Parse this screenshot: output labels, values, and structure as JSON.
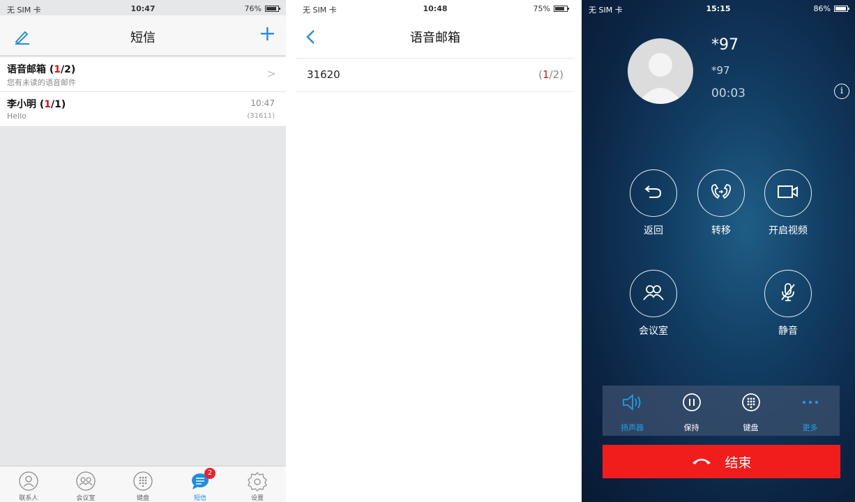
{
  "screen1": {
    "status": {
      "carrier": "无 SIM 卡",
      "time": "10:47",
      "battery": "76%",
      "battery_level": 0.76
    },
    "nav": {
      "title": "短信"
    },
    "messages": [
      {
        "title": "语音邮箱 ",
        "count_left": "(",
        "count_unread": "1",
        "count_right": "/2)",
        "subtitle": "您有未读的语音邮件"
      },
      {
        "title": "李小明 ",
        "count_left": "(",
        "count_unread": "1",
        "count_right": "/1)",
        "subtitle": "Hello",
        "time": "10:47",
        "number": "(31611)"
      }
    ],
    "tabs": [
      {
        "label": "联系人",
        "icon": "contacts-icon"
      },
      {
        "label": "会议室",
        "icon": "conference-icon"
      },
      {
        "label": "键盘",
        "icon": "keypad-icon"
      },
      {
        "label": "短信",
        "icon": "message-icon",
        "badge": "2",
        "active": true
      },
      {
        "label": "设置",
        "icon": "settings-icon"
      }
    ]
  },
  "screen2": {
    "status": {
      "carrier": "无 SIM 卡",
      "time": "10:48",
      "battery": "75%",
      "battery_level": 0.75
    },
    "nav": {
      "title": "语音邮箱"
    },
    "voicemail": {
      "number": "31620",
      "count_left": "(",
      "count_unread": "1",
      "count_right": "/2)"
    }
  },
  "screen3": {
    "status": {
      "carrier": "无 SIM 卡",
      "time": "15:15",
      "battery": "86%",
      "battery_level": 0.86
    },
    "call": {
      "name": "*97",
      "number": "*97",
      "timer": "00:03"
    },
    "buttons": [
      {
        "label": "返回",
        "icon": "return-icon"
      },
      {
        "label": "转移",
        "icon": "transfer-icon"
      },
      {
        "label": "开启视频",
        "icon": "video-icon"
      },
      {
        "label": "会议室",
        "icon": "conference-icon"
      },
      {
        "label": "静音",
        "icon": "mute-icon"
      }
    ],
    "panel": [
      {
        "label": "扬声器",
        "icon": "speaker-icon"
      },
      {
        "label": "保持",
        "icon": "hold-icon"
      },
      {
        "label": "键盘",
        "icon": "keypad-icon"
      },
      {
        "label": "更多",
        "icon": "more-icon"
      }
    ],
    "end_label": "结束",
    "colors": {
      "accent": "#1d8ee0",
      "end": "#f11d1d",
      "unread": "#e01010"
    }
  }
}
